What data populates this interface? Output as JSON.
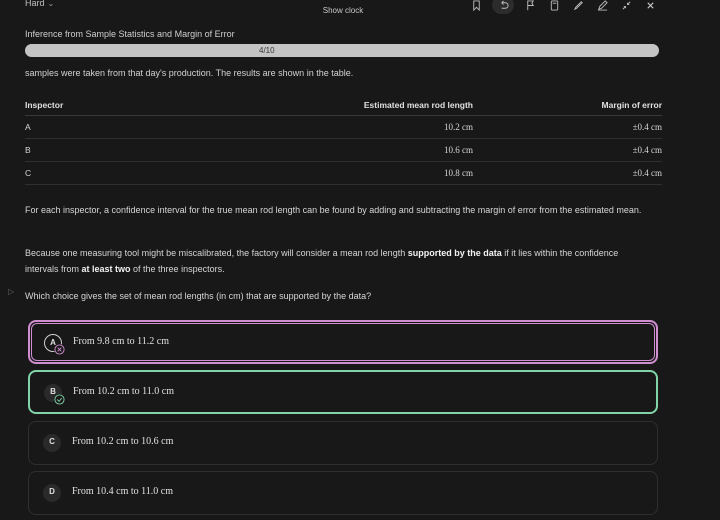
{
  "header": {
    "difficulty": "Hard",
    "show_clock": "Show clock",
    "tools": [
      "bookmark-icon",
      "undo-icon",
      "flag-icon",
      "calculator-icon",
      "highlighter-icon",
      "pen-icon",
      "collapse-icon",
      "close-icon"
    ]
  },
  "section_title": "Inference from Sample Statistics and Margin of Error",
  "progress": {
    "label": "4/10",
    "current": 4,
    "total": 10
  },
  "intro": "samples were taken from that day's production. The results are shown in the table.",
  "table": {
    "headers": [
      "Inspector",
      "Estimated mean rod length",
      "Margin of error"
    ],
    "rows": [
      [
        "A",
        "10.2 cm",
        "±0.4 cm"
      ],
      [
        "B",
        "10.6 cm",
        "±0.4 cm"
      ],
      [
        "C",
        "10.8 cm",
        "±0.4 cm"
      ]
    ]
  },
  "para1": "For each inspector, a confidence interval for the true mean rod length can be found by adding and subtracting the margin of error from the estimated mean.",
  "para2": {
    "a": "Because one measuring tool might be miscalibrated, the factory will consider a mean rod length ",
    "b": "supported by the data",
    "c": " if it lies within the confidence intervals from ",
    "d": "at least two",
    "e": " of the three inspectors."
  },
  "question": "Which choice gives the set of mean rod lengths (in cm) that are supported by the data?",
  "choices": [
    {
      "letter": "A",
      "text": "From 9.8 cm to 11.2 cm",
      "state": "incorrect"
    },
    {
      "letter": "B",
      "text": "From 10.2 cm to 11.0 cm",
      "state": "correct"
    },
    {
      "letter": "C",
      "text": "From 10.2 cm to 10.6 cm",
      "state": "none"
    },
    {
      "letter": "D",
      "text": "From 10.4 cm to 11.0 cm",
      "state": "none"
    }
  ],
  "colors": {
    "background": "#181818",
    "incorrect": "#cf8ecf",
    "correct": "#82d3a8"
  }
}
